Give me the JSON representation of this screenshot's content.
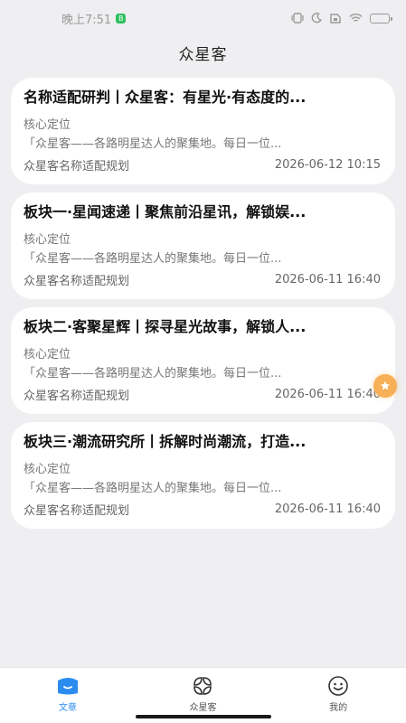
{
  "status_bar": {
    "time": "晚上7:51",
    "notification_badge": "B",
    "colors": {
      "text": "#9a9a9a",
      "battery_green": "#2fbf5f"
    },
    "battery_level": 0.7
  },
  "header": {
    "title": "众星客"
  },
  "articles": [
    {
      "title": "名称适配研判丨众星客：有星光·有态度的...",
      "subtitle": "核心定位",
      "excerpt": "「众星客——各路明星达人的聚集地。每日一位...",
      "source": "众星客名称适配规划",
      "date": "2026-06-12 10:15"
    },
    {
      "title": "板块一·星闻速递丨聚焦前沿星讯，解锁娱...",
      "subtitle": "核心定位",
      "excerpt": "「众星客——各路明星达人的聚集地。每日一位...",
      "source": "众星客名称适配规划",
      "date": "2026-06-11 16:40"
    },
    {
      "title": "板块二·客聚星辉丨探寻星光故事，解锁人...",
      "subtitle": "核心定位",
      "excerpt": "「众星客——各路明星达人的聚集地。每日一位...",
      "source": "众星客名称适配规划",
      "date": "2026-06-11 16:40"
    },
    {
      "title": "板块三·潮流研究所丨拆解时尚潮流，打造...",
      "subtitle": "核心定位",
      "excerpt": "「众星客——各路明星达人的聚集地。每日一位...",
      "source": "众星客名称适配规划",
      "date": "2026-06-11 16:40"
    }
  ],
  "floating_button": {
    "icon": "star-icon",
    "color": "#f7b057"
  },
  "bottom_nav": {
    "items": [
      {
        "label": "文章",
        "icon": "article-icon",
        "active": true
      },
      {
        "label": "众星客",
        "icon": "grid-icon",
        "active": false
      },
      {
        "label": "我的",
        "icon": "smiley-icon",
        "active": false
      }
    ],
    "active_color": "#2b8cf0"
  }
}
